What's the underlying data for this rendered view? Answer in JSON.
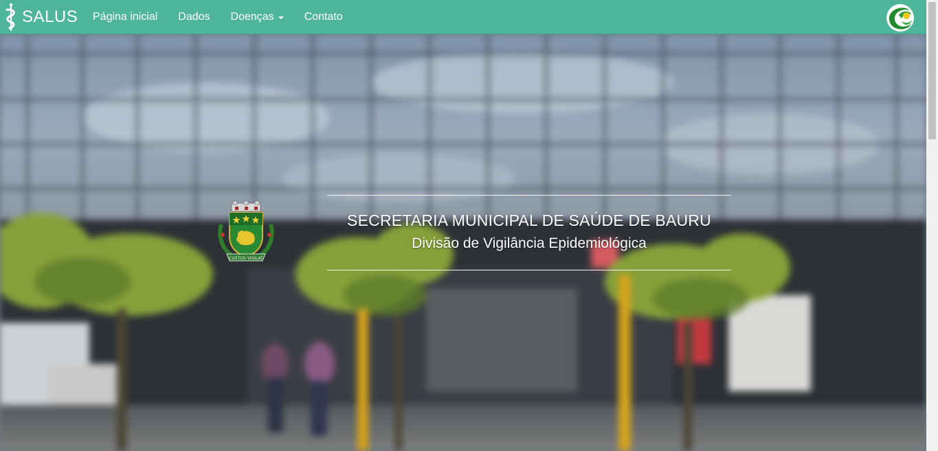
{
  "brand": {
    "name": "SALUS",
    "icon": "caduceus-icon"
  },
  "nav": {
    "items": [
      {
        "label": "Página inicial"
      },
      {
        "label": "Dados"
      },
      {
        "label": "Doenças",
        "dropdown": true
      },
      {
        "label": "Contato"
      }
    ],
    "right_logo": "green-swirl-logo"
  },
  "hero": {
    "title": "SECRETARIA MUNICIPAL DE SAÚDE DE BAURU",
    "subtitle": "Divisão de Vigilância Epidemiológica",
    "crest_motto": "CUSTOS VIGILAT",
    "background": "blurred photo of health department building with glass facade and trees"
  },
  "colors": {
    "navbar": "#4eb59a",
    "text": "#ffffff"
  }
}
